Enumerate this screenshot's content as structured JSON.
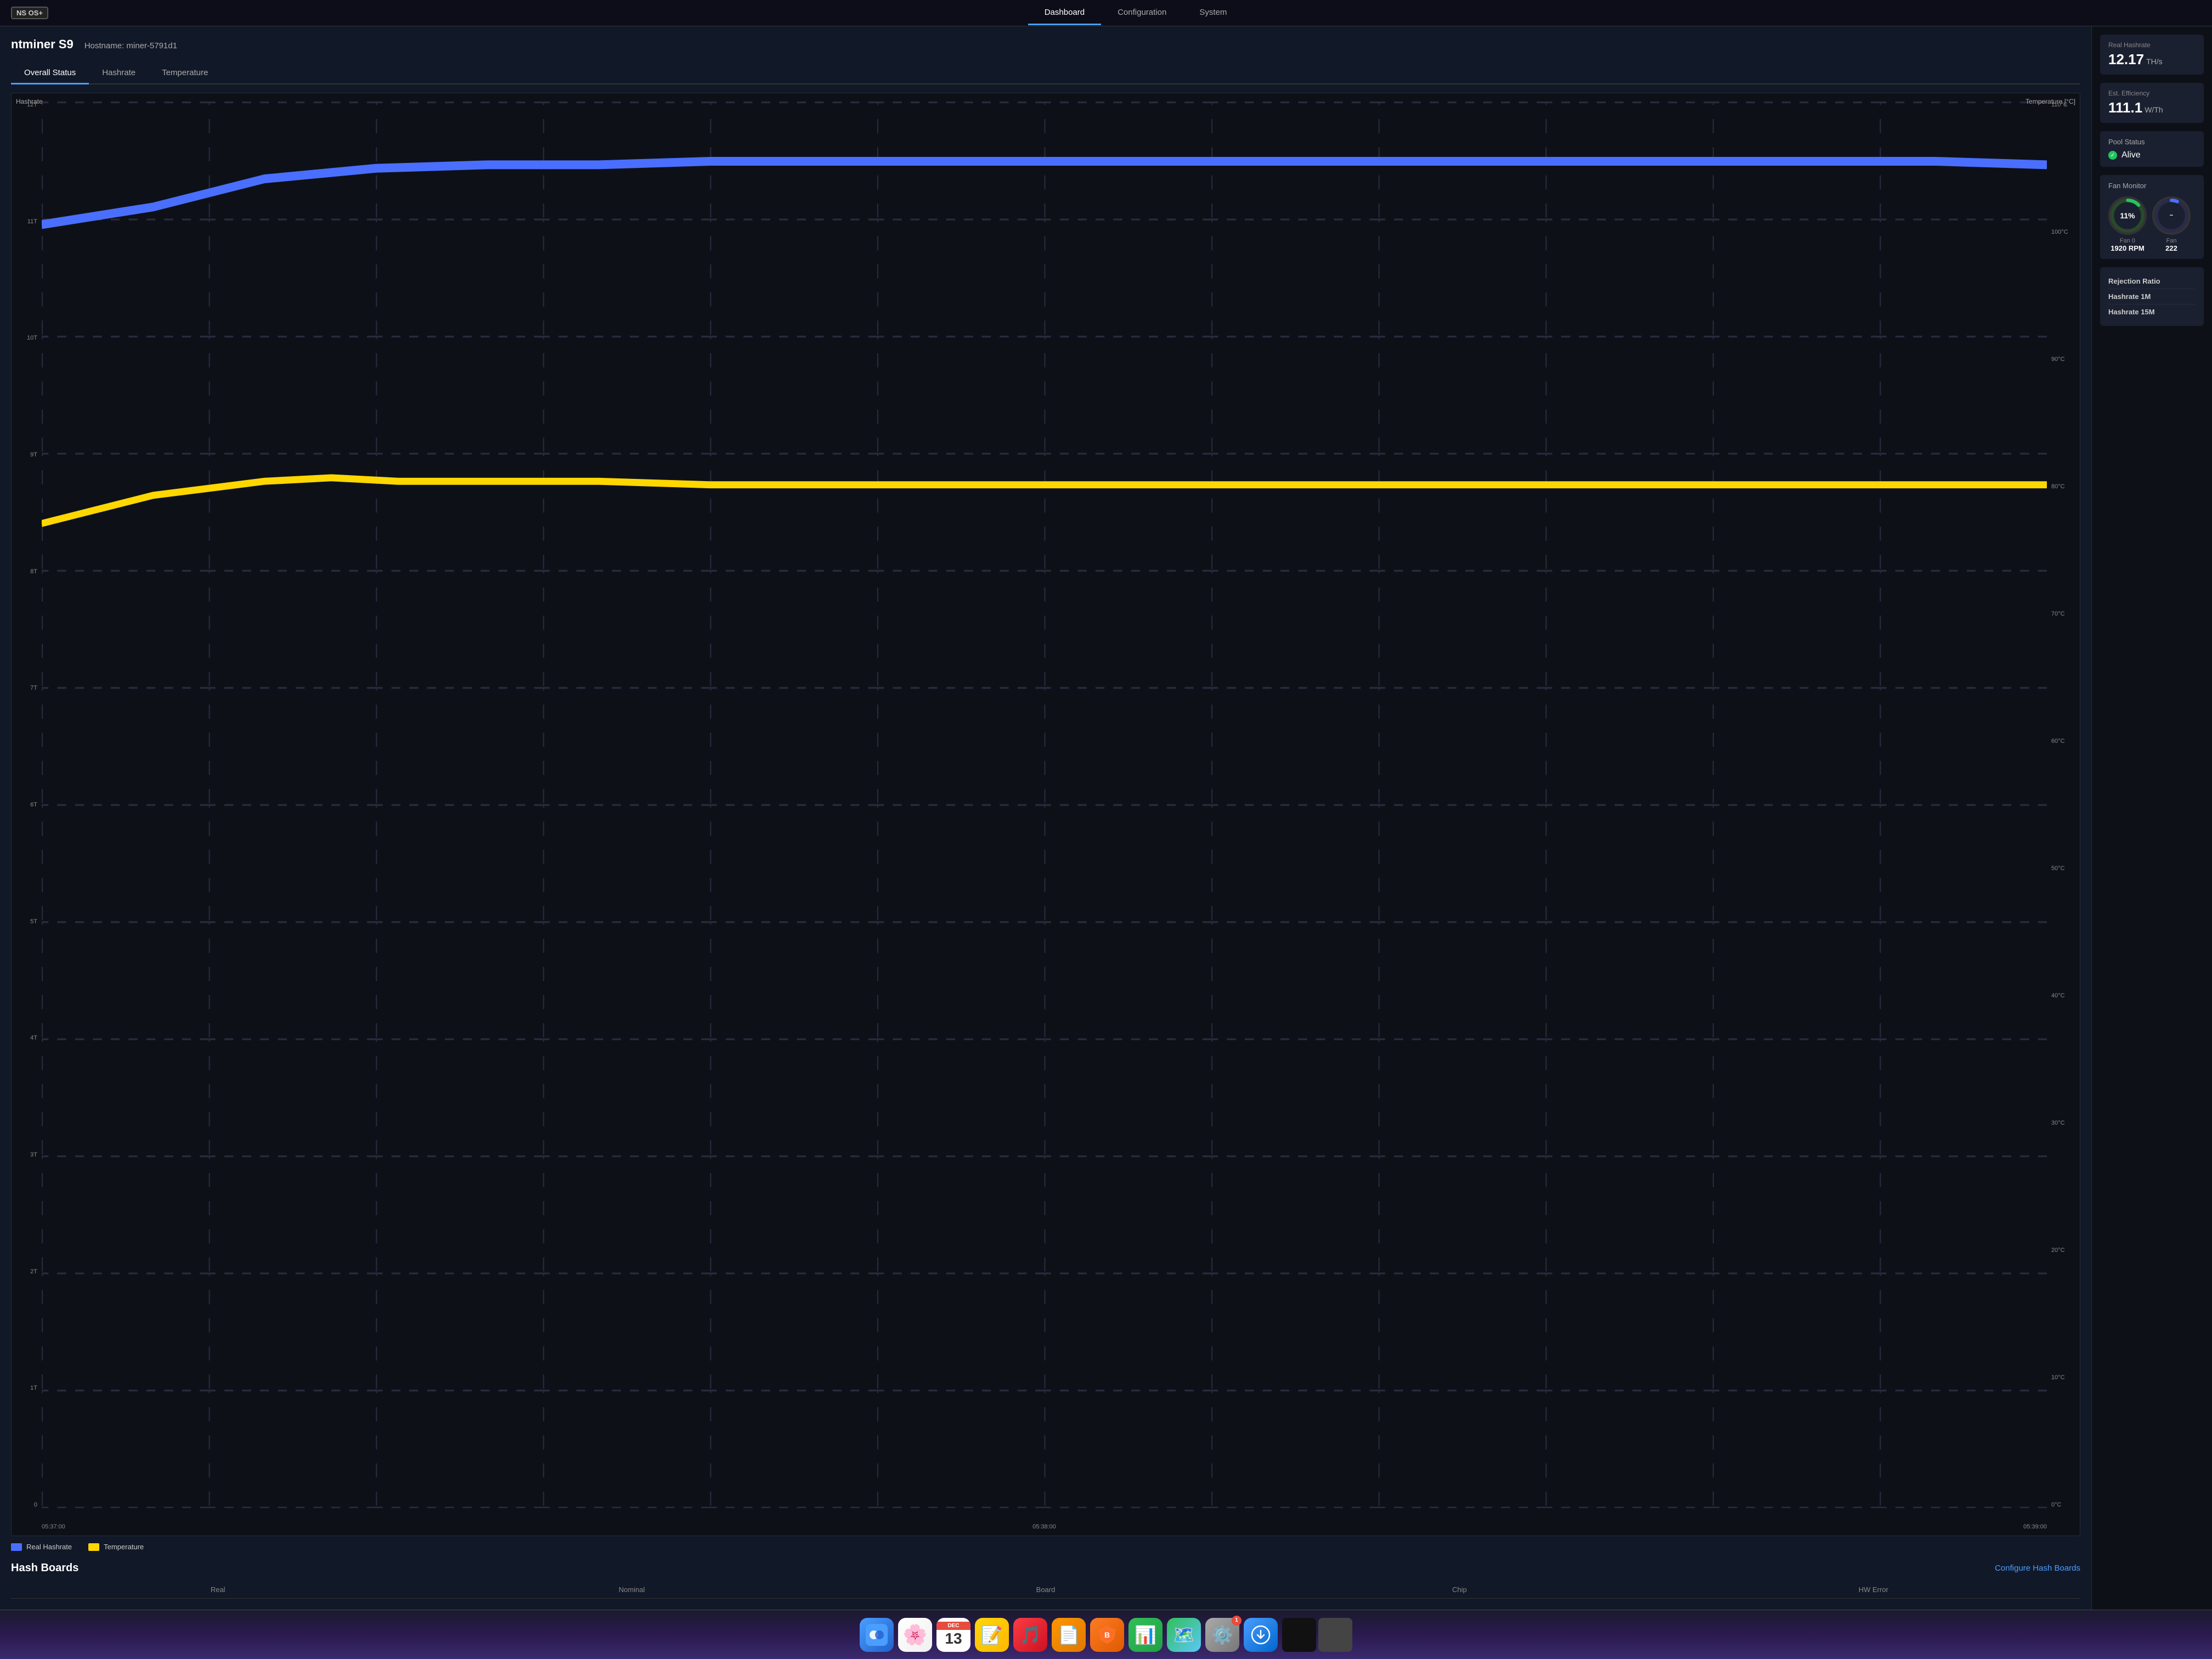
{
  "top_nav": {
    "logo": "NS OS+",
    "tabs": [
      {
        "label": "Dashboard",
        "active": true
      },
      {
        "label": "Configuration",
        "active": false
      },
      {
        "label": "System",
        "active": false
      }
    ]
  },
  "device": {
    "name": "ntminer S9",
    "hostname": "Hostname: miner-5791d1"
  },
  "panel_tabs": [
    {
      "label": "Overall Status",
      "active": true
    },
    {
      "label": "Hashrate",
      "active": false
    },
    {
      "label": "Temperature",
      "active": false
    }
  ],
  "chart": {
    "axis_left_label": "Hashrate",
    "axis_right_label": "Temperature [°C]",
    "y_left_labels": [
      "12T",
      "11T",
      "10T",
      "9T",
      "8T",
      "7T",
      "6T",
      "5T",
      "4T",
      "3T",
      "2T",
      "1T",
      "0"
    ],
    "y_right_labels": [
      "110°C",
      "100°C",
      "90°C",
      "80°C",
      "70°C",
      "60°C",
      "50°C",
      "40°C",
      "30°C",
      "20°C",
      "10°C",
      "0°C"
    ],
    "x_labels": [
      "05:37:00",
      "05:38:00",
      "05:39:00"
    ],
    "legend": [
      {
        "label": "Real Hashrate",
        "color": "#4a6fff"
      },
      {
        "label": "Temperature",
        "color": "#ffd700"
      }
    ]
  },
  "sidebar": {
    "real_hashrate_label": "Real Hashrate",
    "real_hashrate_value": "12.17",
    "real_hashrate_unit": "TH/s",
    "est_efficiency_label": "Est. Efficiency",
    "est_efficiency_value": "111.1",
    "est_efficiency_unit": "W/Th",
    "pool_status_label": "Pool Status",
    "pool_status_value": "Alive",
    "fan_monitor_label": "Fan Monitor",
    "fan0_label": "Fan 0",
    "fan0_rpm": "1920 RPM",
    "fan0_pct": "11%",
    "fan1_label": "Fan",
    "fan1_rpm": "222",
    "rejection_ratio_label": "Rejection Ratio",
    "hashrate_1m_label": "Hashrate 1M",
    "hashrate_15m_label": "Hashrate 15M"
  },
  "hashboards": {
    "title": "Hash Boards",
    "configure_link": "Configure Hash Boards",
    "table_headers": [
      "Real",
      "Nominal",
      "Board",
      "Chip",
      "HW Error"
    ]
  },
  "dock": {
    "calendar_month": "DEC",
    "calendar_day": "13",
    "settings_badge": "1"
  }
}
